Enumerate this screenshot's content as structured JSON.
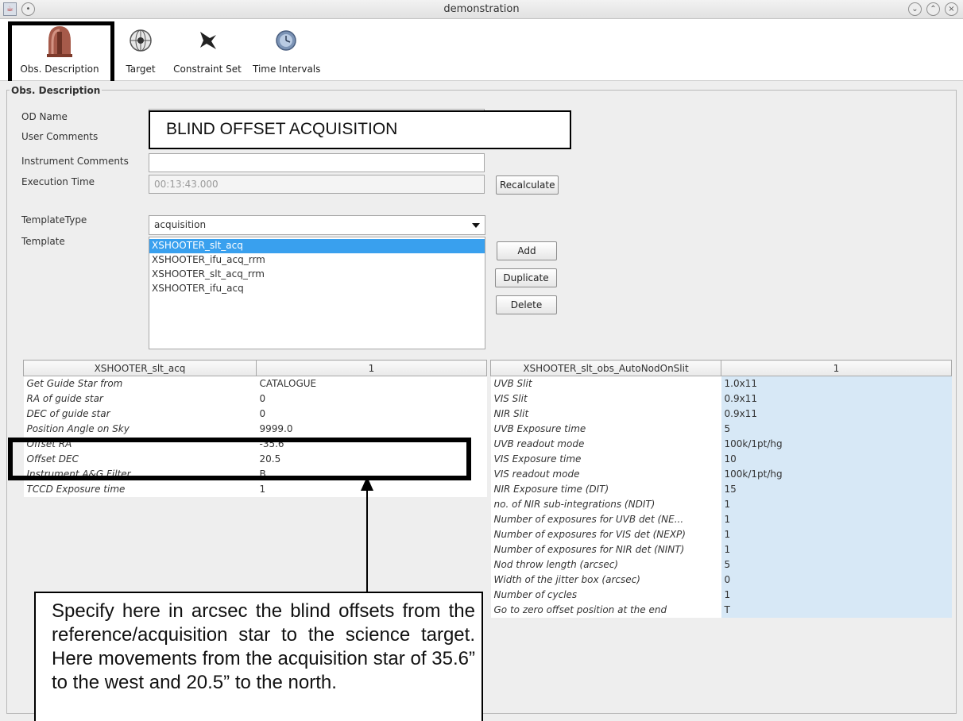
{
  "window": {
    "title": "demonstration",
    "app_icon": "java-cup-icon",
    "controls": [
      "minimize",
      "maximize",
      "close"
    ]
  },
  "toolbar": {
    "items": [
      {
        "label": "Obs. Description",
        "icon": "telescope-dome-icon"
      },
      {
        "label": "Target",
        "icon": "globe-target-icon"
      },
      {
        "label": "Constraint Set",
        "icon": "star-constraint-icon"
      },
      {
        "label": "Time Intervals",
        "icon": "clock-sphere-icon"
      }
    ]
  },
  "panel": {
    "legend": "Obs. Description",
    "fields": {
      "od_name_label": "OD Name",
      "user_comments_label": "User Comments",
      "instrument_comments_label": "Instrument Comments",
      "execution_time_label": "Execution Time",
      "execution_time_value": "00:13:43.000",
      "template_type_label": "TemplateType",
      "template_type_value": "acquisition",
      "template_label": "Template"
    },
    "callout": "BLIND OFFSET ACQUISITION",
    "buttons": {
      "recalculate": "Recalculate",
      "add": "Add",
      "duplicate": "Duplicate",
      "delete": "Delete"
    },
    "templates": [
      "XSHOOTER_slt_acq",
      "XSHOOTER_ifu_acq_rrm",
      "XSHOOTER_slt_acq_rrm",
      "XSHOOTER_ifu_acq"
    ],
    "selected_template": "XSHOOTER_slt_acq"
  },
  "left_table": {
    "headers": [
      "XSHOOTER_slt_acq",
      "1"
    ],
    "rows": [
      [
        "Get Guide Star from",
        "CATALOGUE"
      ],
      [
        "RA of guide star",
        "0"
      ],
      [
        "DEC of guide star",
        "0"
      ],
      [
        "Position Angle on Sky",
        "9999.0"
      ],
      [
        "Offset RA",
        "-35.6"
      ],
      [
        "Offset DEC",
        "20.5"
      ],
      [
        "Instrument A&G Filter",
        "B"
      ],
      [
        "TCCD Exposure time",
        "1"
      ]
    ]
  },
  "right_table": {
    "headers": [
      "XSHOOTER_slt_obs_AutoNodOnSlit",
      "1"
    ],
    "rows": [
      [
        "UVB Slit",
        "1.0x11"
      ],
      [
        "VIS Slit",
        "0.9x11"
      ],
      [
        "NIR Slit",
        "0.9x11"
      ],
      [
        "UVB Exposure time",
        "5"
      ],
      [
        "UVB readout mode",
        "100k/1pt/hg"
      ],
      [
        "VIS Exposure time",
        "10"
      ],
      [
        "VIS readout mode",
        "100k/1pt/hg"
      ],
      [
        "NIR Exposure time (DIT)",
        "15"
      ],
      [
        "no. of NIR sub-integrations (NDIT)",
        "1"
      ],
      [
        "Number of exposures for UVB det (NE...",
        "1"
      ],
      [
        "Number of exposures for VIS det (NEXP)",
        "1"
      ],
      [
        "Number of exposures for NIR det (NINT)",
        "1"
      ],
      [
        "Nod throw length (arcsec)",
        "5"
      ],
      [
        "Width of the jitter box (arcsec)",
        "0"
      ],
      [
        "Number of cycles",
        "1"
      ],
      [
        "Go to zero offset position at the end",
        "T"
      ]
    ]
  },
  "annotation": {
    "note": "Specify here in arcsec the blind offsets from the reference/acquisition star to the science target. Here movements from the acquisition star of 35.6” to the west and 20.5” to the north."
  }
}
